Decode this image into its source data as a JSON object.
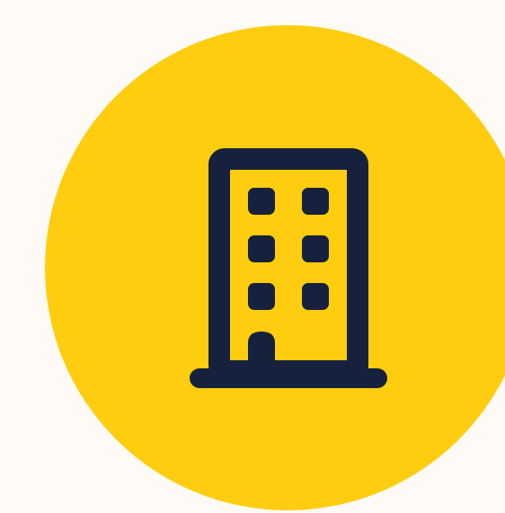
{
  "colors": {
    "background": "#fffaf5",
    "badge": "#ffcd0f",
    "icon": "#16223d"
  },
  "badge": {
    "icon": "building-icon"
  }
}
